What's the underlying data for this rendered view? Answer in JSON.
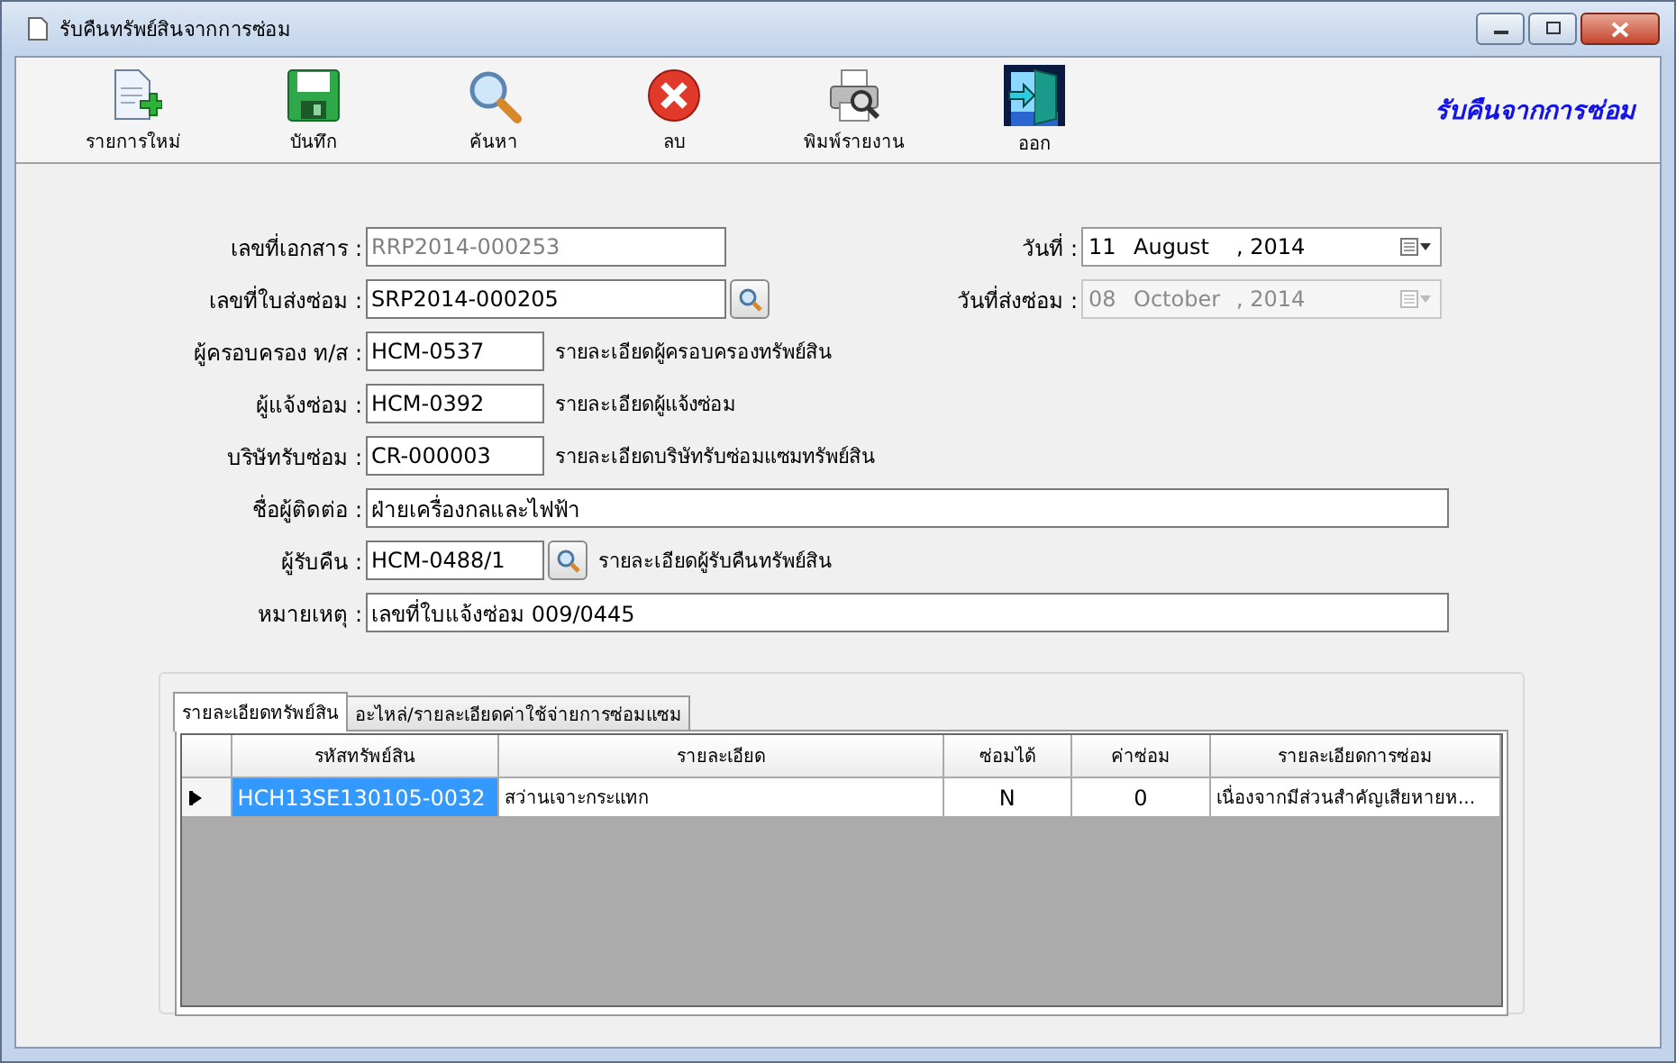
{
  "window": {
    "title": "รับคืนทรัพย์สินจากการซ่อม"
  },
  "toolbar": {
    "items": [
      {
        "kind": "new",
        "label": "รายการใหม่"
      },
      {
        "kind": "save",
        "label": "บันทึก"
      },
      {
        "kind": "search",
        "label": "ค้นหา"
      },
      {
        "kind": "delete",
        "label": "ลบ"
      },
      {
        "kind": "print",
        "label": "พิมพ์รายงาน"
      },
      {
        "kind": "exit",
        "label": "ออก"
      }
    ],
    "heading": "รับคืนจากการซ่อม"
  },
  "form": {
    "fields": [
      {
        "label": "เลขที่เอกสาร :",
        "value": "RRP2014-000253",
        "disabled": true,
        "lookup": false
      },
      {
        "label": "เลขที่ใบส่งซ่อม :",
        "value": "SRP2014-000205",
        "disabled": false,
        "lookup": true
      },
      {
        "label": "ผู้ครอบครอง ท/ส :",
        "value": "HCM-0537",
        "disabled": false,
        "lookup": false,
        "description": "รายละเอียดผู้ครอบครองทรัพย์สิน"
      },
      {
        "label": "ผู้แจ้งซ่อม :",
        "value": "HCM-0392",
        "disabled": false,
        "lookup": false,
        "description": "รายละเอียดผู้แจ้งซ่อม"
      },
      {
        "label": "บริษัทรับซ่อม :",
        "value": "CR-000003",
        "disabled": false,
        "lookup": false,
        "description": "รายละเอียดบริษัทรับซ่อมแซมทรัพย์สิน"
      },
      {
        "label": "ชื่อผู้ติดต่อ :",
        "value": "ฝ่ายเครื่องกลและไฟฟ้า",
        "disabled": false,
        "lookup": false
      },
      {
        "label": "ผู้รับคืน :",
        "value": "HCM-0488/1",
        "disabled": false,
        "lookup": true,
        "description": "รายละเอียดผู้รับคืนทรัพย์สิน"
      },
      {
        "label": "หมายเหตุ :",
        "value": "เลขที่ใบแจ้งซ่อม 009/0445",
        "disabled": false,
        "lookup": false
      }
    ],
    "dates": [
      {
        "label": "วันที่ :",
        "day": "11",
        "month": "August",
        "year": ", 2014",
        "disabled": false
      },
      {
        "label": "วันที่ส่งซ่อม :",
        "day": "08",
        "month": "October",
        "year": ", 2014",
        "disabled": true
      }
    ]
  },
  "tabs": [
    {
      "label": "รายละเอียดทรัพย์สิน",
      "selected": true
    },
    {
      "label": "อะไหล่/รายละเอียดค่าใช้จ่ายการซ่อมแซม",
      "selected": false
    }
  ],
  "table": {
    "columns": [
      "รหัสทรัพย์สิน",
      "รายละเอียด",
      "ซ่อมได้",
      "ค่าซ่อม",
      "รายละเอียดการซ่อม"
    ],
    "rows": [
      {
        "current": true,
        "cells": [
          {
            "text": "HCH13SE130105-0032",
            "selected": true
          },
          {
            "text": "สว่านเจาะกระแทก",
            "selected": false
          },
          {
            "text": "N",
            "selected": false
          },
          {
            "text": "0",
            "selected": false
          },
          {
            "text": "เนื่องจากมีส่วนสำคัญเสียหายห...",
            "selected": false
          }
        ]
      }
    ]
  }
}
